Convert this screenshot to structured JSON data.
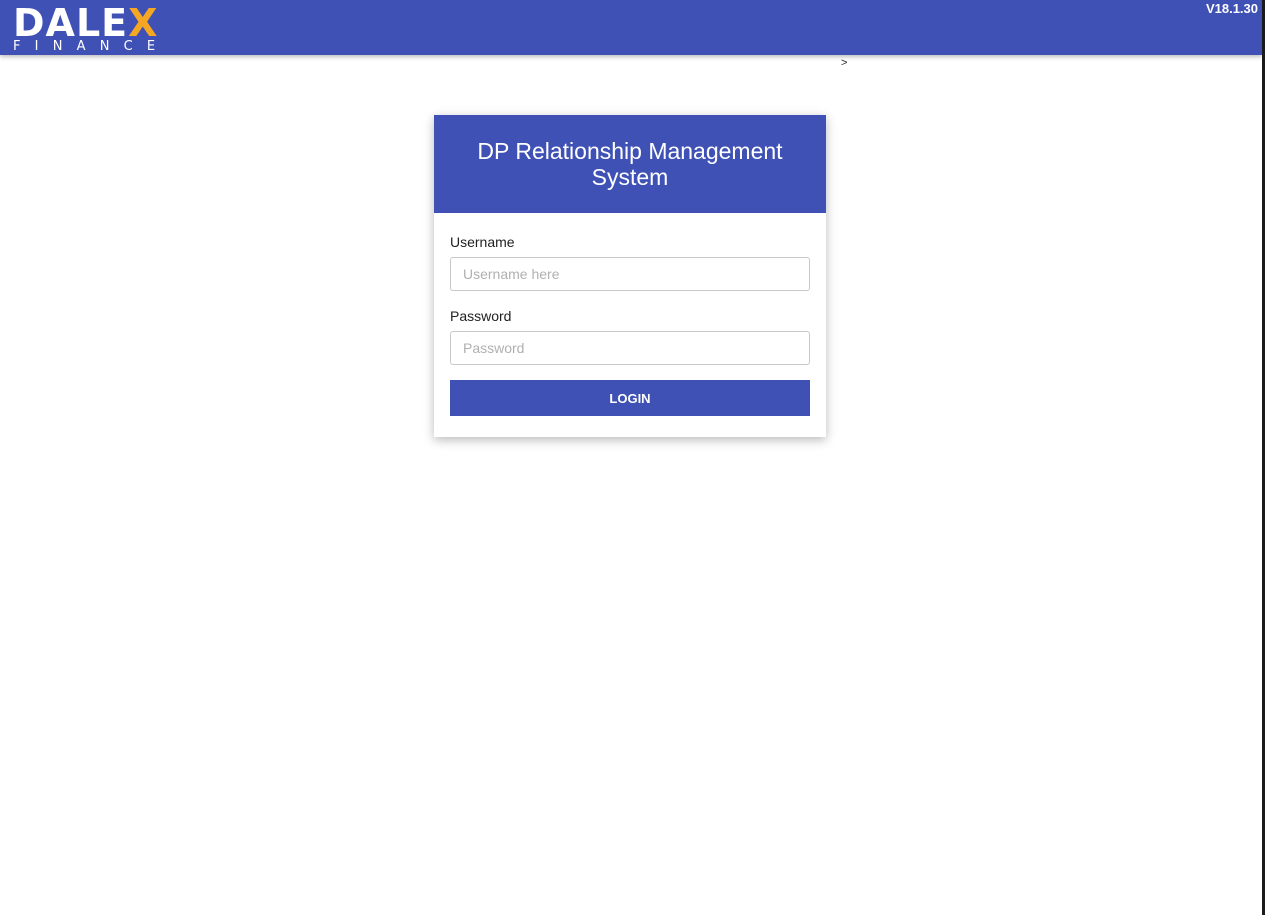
{
  "header": {
    "logo": {
      "word_main": "DALE",
      "word_accent": "X",
      "subtitle": "FINANCE"
    },
    "version": "V18.1.30"
  },
  "breadcrumb": {
    "separator": ">"
  },
  "login": {
    "title": "DP Relationship Management System",
    "username": {
      "label": "Username",
      "value": "",
      "placeholder": "Username here"
    },
    "password": {
      "label": "Password",
      "value": "",
      "placeholder": "Password"
    },
    "submit_label": "LOGIN"
  },
  "colors": {
    "primary": "#3f51b5",
    "logo_accent": "#f5a623"
  }
}
